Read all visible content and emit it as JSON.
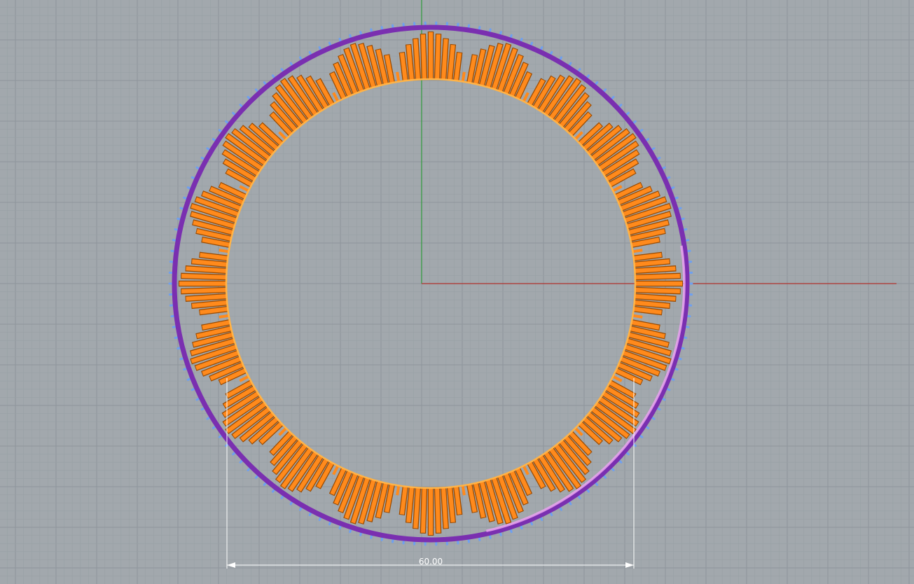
{
  "viewport": {
    "background_color": "#a2a8ad",
    "minor_grid_color": "#98a0a5",
    "major_grid_color": "#8e959b",
    "x_axis_color": "#b0302c",
    "y_axis_color": "#2e9a3a"
  },
  "model": {
    "ring_color": "#7a2fb0",
    "ring_highlight_color": "#e9a2f0",
    "tooth_color": "#6fa0f0",
    "fin_color": "#ff8a1c",
    "fin_outline_color": "#9a4a00",
    "inner_rim_color": "#ffb347",
    "fin_groups": 20
  },
  "dimension": {
    "label": "60.00",
    "line_color": "#ffffff"
  }
}
